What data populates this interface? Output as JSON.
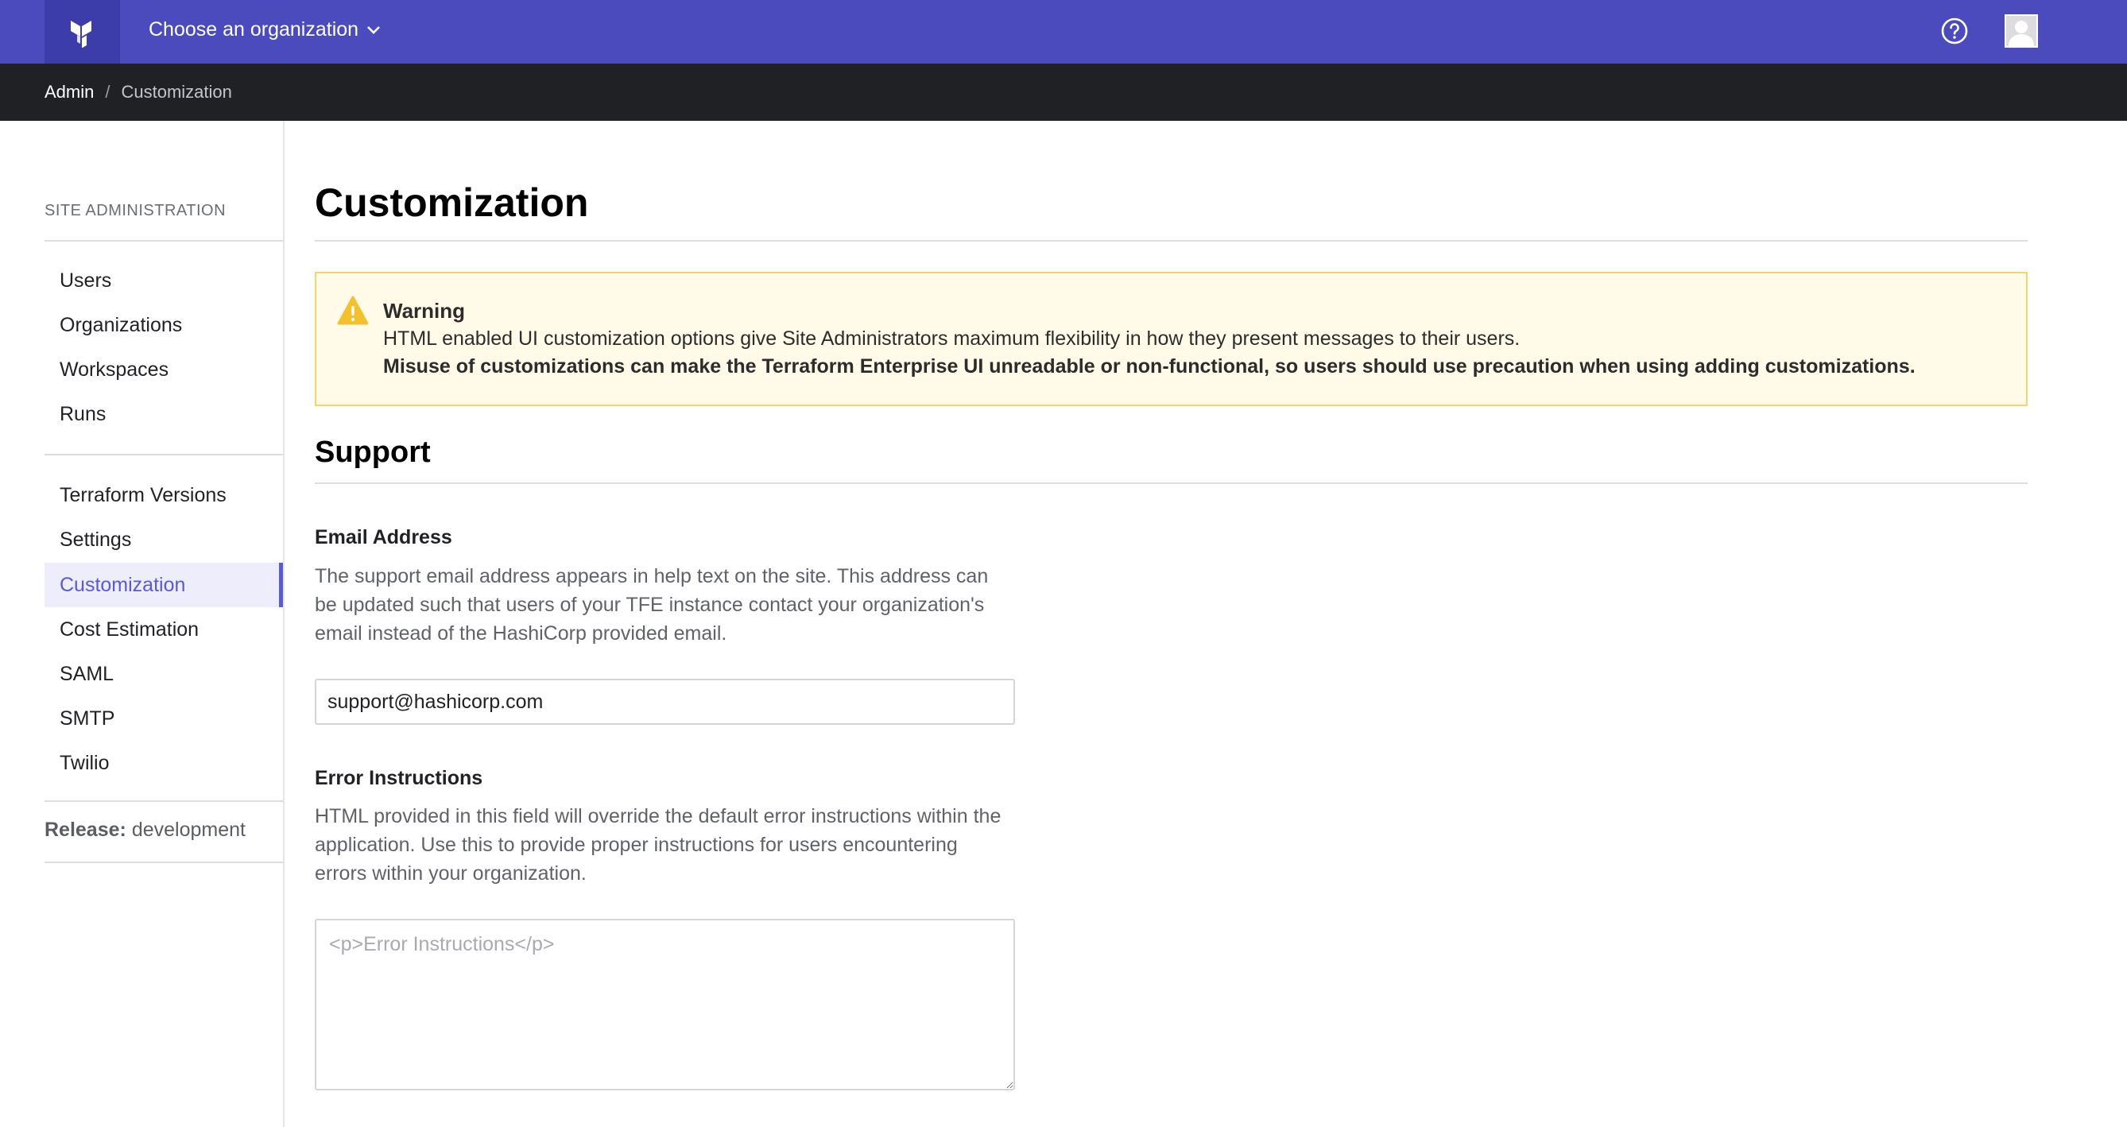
{
  "topbar": {
    "org_chooser_label": "Choose an organization",
    "icons": {
      "logo": "terraform-logo-icon",
      "chevron": "chevron-down-icon",
      "help": "help-circle-icon",
      "avatar": "user-avatar-icon"
    }
  },
  "breadcrumb": {
    "root": "Admin",
    "separator": "/",
    "current": "Customization"
  },
  "sidebar": {
    "heading": "SITE ADMINISTRATION",
    "group1": [
      {
        "label": "Users"
      },
      {
        "label": "Organizations"
      },
      {
        "label": "Workspaces"
      },
      {
        "label": "Runs"
      }
    ],
    "group2": [
      {
        "label": "Terraform Versions"
      },
      {
        "label": "Settings"
      },
      {
        "label": "Customization",
        "active": true
      },
      {
        "label": "Cost Estimation"
      },
      {
        "label": "SAML"
      },
      {
        "label": "SMTP"
      },
      {
        "label": "Twilio"
      }
    ],
    "release_label": "Release:",
    "release_value": "development"
  },
  "main": {
    "title": "Customization",
    "warning": {
      "icon": "warning-triangle-icon",
      "title": "Warning",
      "line1": "HTML enabled UI customization options give Site Administrators maximum flexibility in how they present messages to their users.",
      "line2": "Misuse of customizations can make the Terraform Enterprise UI unreadable or non-functional, so users should use precaution when using adding customizations."
    },
    "support": {
      "title": "Support",
      "email": {
        "label": "Email Address",
        "help": "The support email address appears in help text on the site. This address can be updated such that users of your TFE instance contact your organization's email instead of the HashiCorp provided email.",
        "value": "support@hashicorp.com"
      },
      "error_instructions": {
        "label": "Error Instructions",
        "help": "HTML provided in this field will override the default error instructions within the application. Use this to provide proper instructions for users encountering errors within your organization.",
        "placeholder": "<p>Error Instructions</p>"
      }
    }
  },
  "colors": {
    "topbar": "#4b4bbd",
    "breadcrumb_bar": "#1f2124",
    "accent": "#5a5ad1",
    "warning_bg": "#fffbe8",
    "warning_border": "#f3d56b"
  }
}
